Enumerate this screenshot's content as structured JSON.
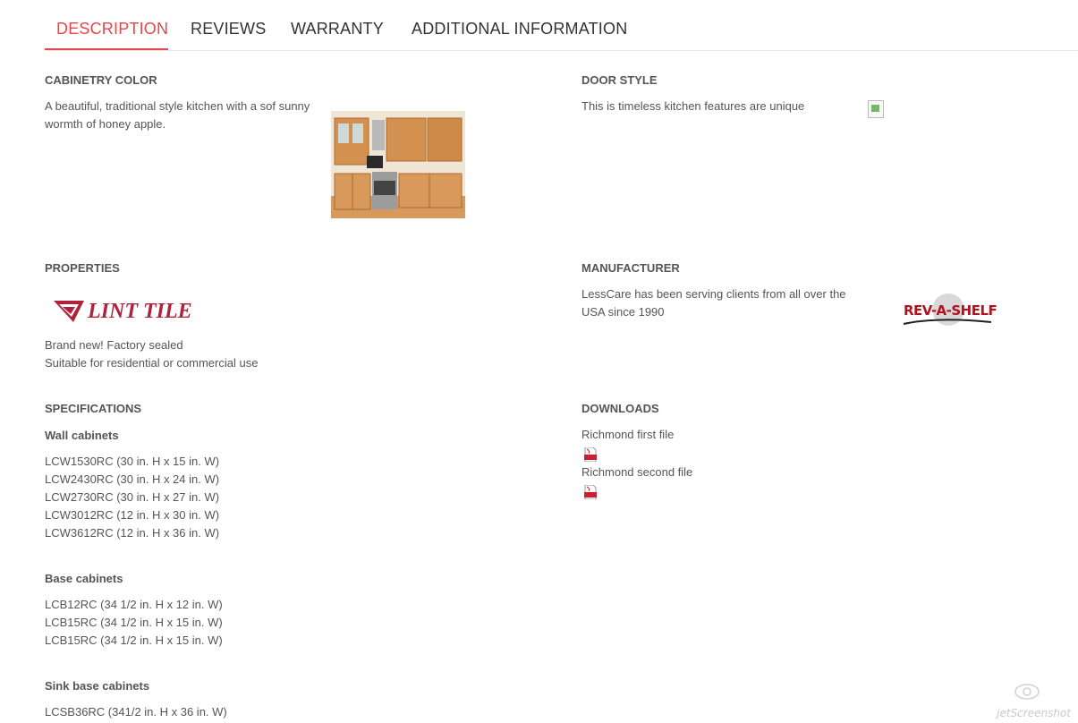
{
  "tabs": [
    {
      "label": "DESCRIPTION",
      "active": true
    },
    {
      "label": "REVIEWS",
      "active": false
    },
    {
      "label": "WARRANTY",
      "active": false
    },
    {
      "label": "ADDITIONAL INFORMATION",
      "active": false
    }
  ],
  "colors": {
    "accent": "#e8474a",
    "text": "#555555"
  },
  "cabinetry": {
    "heading": "CABINETRY COLOR",
    "text": "A beautiful, traditional style kitchen with a sof sunny wormth of honey apple.",
    "image": "kitchen-photo"
  },
  "door": {
    "heading": "DOOR STYLE",
    "text": "This is timeless kitchen features are unique",
    "image": "broken-image-icon"
  },
  "properties": {
    "heading": "PROPERTIES",
    "logo_text": "LINT TILE",
    "lines": [
      "Brand new! Factory sealed",
      "Suitable for residential or commercial use"
    ]
  },
  "manufacturer": {
    "heading": "MANUFACTURER",
    "text": "LessCare has been serving clients from all over the USA since 1990",
    "logo_text": "REV-A-SHELF"
  },
  "specifications": {
    "heading": "SPECIFICATIONS",
    "groups": [
      {
        "title": "Wall cabinets",
        "items": [
          "LCW1530RC (30 in. H x 15 in. W)",
          "LCW2430RC (30 in. H x 24 in. W)",
          "LCW2730RC (30 in. H x 27 in. W)",
          "LCW3012RC (12 in. H x 30 in. W)",
          "LCW3612RC (12 in. H x 36 in. W)"
        ]
      },
      {
        "title": "Base cabinets",
        "items": [
          "LCB12RC (34 1/2 in. H x 12 in. W)",
          "LCB15RC (34 1/2 in. H x 15 in. W)",
          "LCB15RC (34 1/2 in. H x 15 in. W)"
        ]
      },
      {
        "title": "Sink base cabinets",
        "items": [
          "LCSB36RC (341/2 in. H x 36 in. W)"
        ]
      }
    ]
  },
  "downloads": {
    "heading": "DOWNLOADS",
    "files": [
      {
        "name": "Richmond first file",
        "icon": "pdf-icon"
      },
      {
        "name": "Richmond second file",
        "icon": "pdf-icon"
      }
    ]
  },
  "watermark": "jetScreenshot"
}
